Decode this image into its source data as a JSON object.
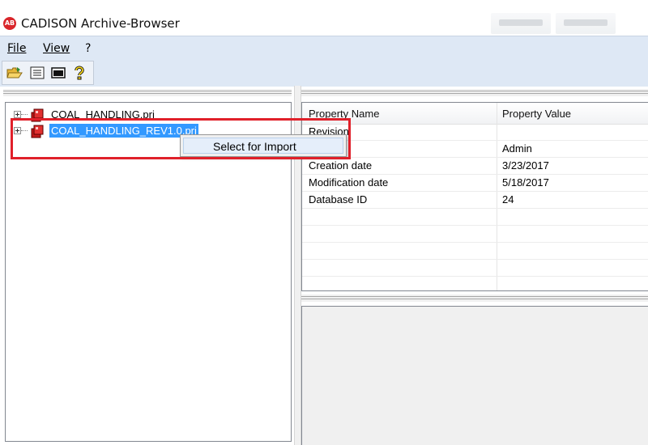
{
  "window": {
    "title": "CADISON Archive-Browser",
    "app_icon_text": "AB"
  },
  "menu": {
    "items": [
      {
        "label": "File"
      },
      {
        "label": "View"
      },
      {
        "label": "?"
      }
    ]
  },
  "toolbar": {
    "buttons": [
      {
        "icon": "open-folder-icon"
      },
      {
        "icon": "list-view-icon"
      },
      {
        "icon": "window-icon"
      },
      {
        "icon": "help-icon"
      }
    ]
  },
  "tree": {
    "items": [
      {
        "label": "COAL_HANDLING.pri",
        "selected": false
      },
      {
        "label": "COAL_HANDLING_REV1.0.pri",
        "selected": true
      }
    ]
  },
  "context_menu": {
    "items": [
      {
        "label": "Select for Import"
      }
    ]
  },
  "properties": {
    "columns": [
      "Property Name",
      "Property Value"
    ],
    "rows": [
      {
        "name": "Revision",
        "value": ""
      },
      {
        "name": "",
        "value": "Admin"
      },
      {
        "name": "Creation date",
        "value": "3/23/2017"
      },
      {
        "name": "Modification date",
        "value": "5/18/2017"
      },
      {
        "name": "Database ID",
        "value": "24"
      }
    ]
  },
  "colors": {
    "selection": "#3399ff",
    "highlight_box": "#e0202a",
    "chrome": "#dee8f5"
  }
}
